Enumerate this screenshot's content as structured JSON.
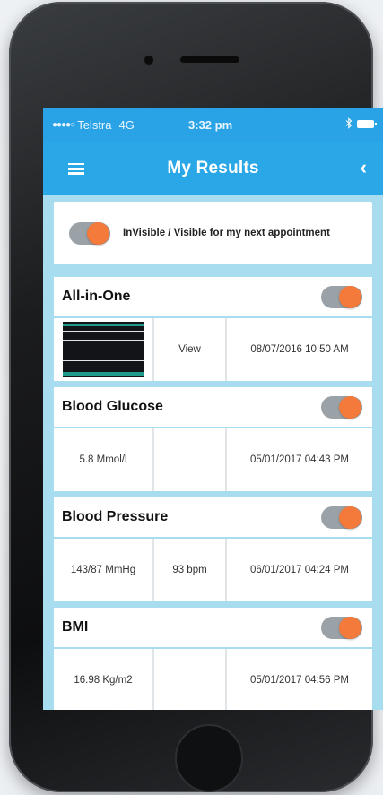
{
  "status_bar": {
    "signal": "●●●●○",
    "carrier": "Telstra",
    "network": "4G",
    "time": "3:32 pm",
    "bluetooth_icon": "bluetooth-icon",
    "battery_icon": "battery-icon"
  },
  "nav": {
    "title": "My Results",
    "menu_icon": "hamburger-menu-icon",
    "back_icon": "chevron-left-icon",
    "back_glyph": "‹"
  },
  "visibility": {
    "label": "InVisible / Visible for my next appointment",
    "toggle_on": true
  },
  "colors": {
    "accent": "#2aa7e6",
    "toggle_knob": "#f47a3c",
    "toggle_track": "#9aa2a8",
    "screen_bg": "#a8dcef"
  },
  "results": [
    {
      "title": "All-in-One",
      "toggle_on": true,
      "col1": "",
      "col1_is_thumbnail": true,
      "col2": "View",
      "col3": "08/07/2016 10:50 AM"
    },
    {
      "title": "Blood Glucose",
      "toggle_on": true,
      "col1": "5.8 Mmol/l",
      "col2": "",
      "col3": "05/01/2017 04:43 PM"
    },
    {
      "title": "Blood Pressure",
      "toggle_on": true,
      "col1": "143/87 MmHg",
      "col2": "93 bpm",
      "col3": "06/01/2017 04:24 PM"
    },
    {
      "title": "BMI",
      "toggle_on": true,
      "col1": "16.98 Kg/m2",
      "col2": "",
      "col3": "05/01/2017 04:56 PM"
    }
  ]
}
